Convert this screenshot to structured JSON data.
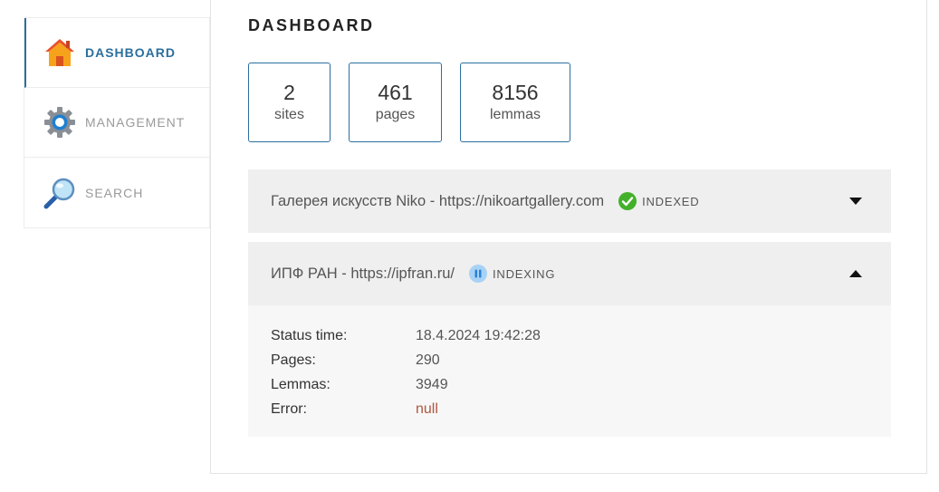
{
  "sidebar": {
    "items": [
      {
        "label": "DASHBOARD",
        "icon": "home-icon",
        "active": true
      },
      {
        "label": "MANAGEMENT",
        "icon": "gear-icon",
        "active": false
      },
      {
        "label": "SEARCH",
        "icon": "magnifier-icon",
        "active": false
      }
    ]
  },
  "page": {
    "title": "DASHBOARD"
  },
  "stats": [
    {
      "value": "2",
      "label": "sites"
    },
    {
      "value": "461",
      "label": "pages"
    },
    {
      "value": "8156",
      "label": "lemmas"
    }
  ],
  "sites": [
    {
      "name": "Галерея искусств Niko - https://nikoartgallery.com",
      "status": "INDEXED",
      "status_color": "#43b02a",
      "expanded": false
    },
    {
      "name": "ИПФ РАН - https://ipfran.ru/",
      "status": "INDEXING",
      "status_color": "#5aa7e6",
      "expanded": true,
      "details": {
        "status_time_label": "Status time:",
        "status_time": "18.4.2024 19:42:28",
        "pages_label": "Pages:",
        "pages": "290",
        "lemmas_label": "Lemmas:",
        "lemmas": "3949",
        "error_label": "Error:",
        "error": "null"
      }
    }
  ],
  "colors": {
    "accent": "#2b6f9e",
    "error": "#b0573f"
  }
}
